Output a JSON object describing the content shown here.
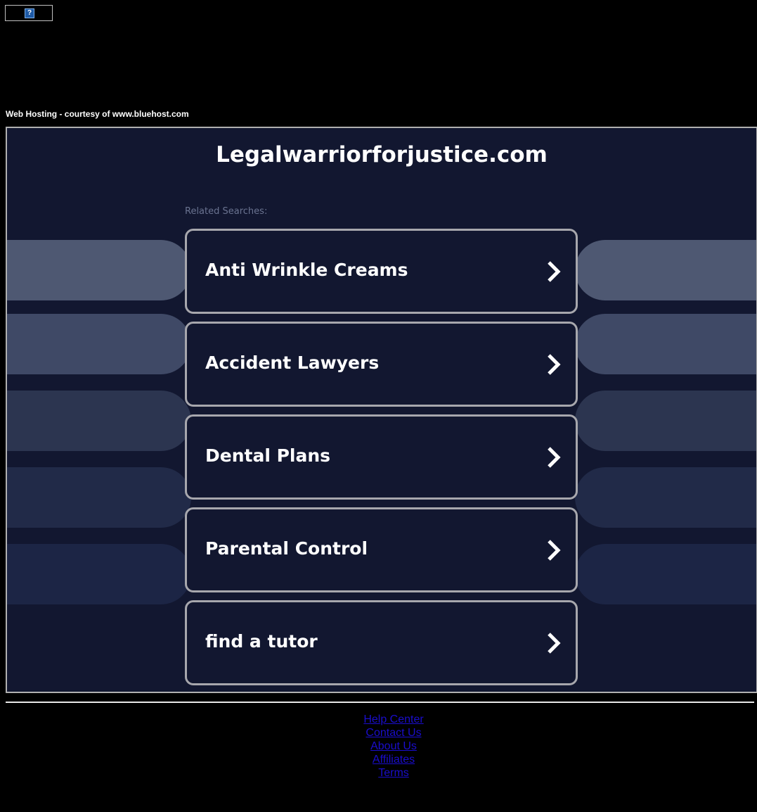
{
  "ad_badge": {
    "icon": "question-mark-icon",
    "glyph": "?"
  },
  "hosting_note": "Web Hosting - courtesy of www.bluehost.com",
  "site_title": "Legalwarriorforjustice.com",
  "related_label": "Related Searches:",
  "searches": [
    {
      "label": "Anti Wrinkle Creams",
      "icon": "chevron-right-icon"
    },
    {
      "label": "Accident Lawyers",
      "icon": "chevron-right-icon"
    },
    {
      "label": "Dental Plans",
      "icon": "chevron-right-icon"
    },
    {
      "label": "Parental Control",
      "icon": "chevron-right-icon"
    },
    {
      "label": "find a tutor",
      "icon": "chevron-right-icon"
    }
  ],
  "footer": {
    "links": [
      "Help Center",
      "Contact Us",
      "About Us",
      "Affiliates",
      "Terms"
    ]
  },
  "colors": {
    "page_background": "#000000",
    "panel_background": "#121730",
    "card_border": "#a7a7ad",
    "link_color": "#1a0dcc",
    "side_pill_shades": [
      "#4e5872",
      "#3f4966",
      "#2c3550",
      "#212a48",
      "#1c2545"
    ]
  }
}
